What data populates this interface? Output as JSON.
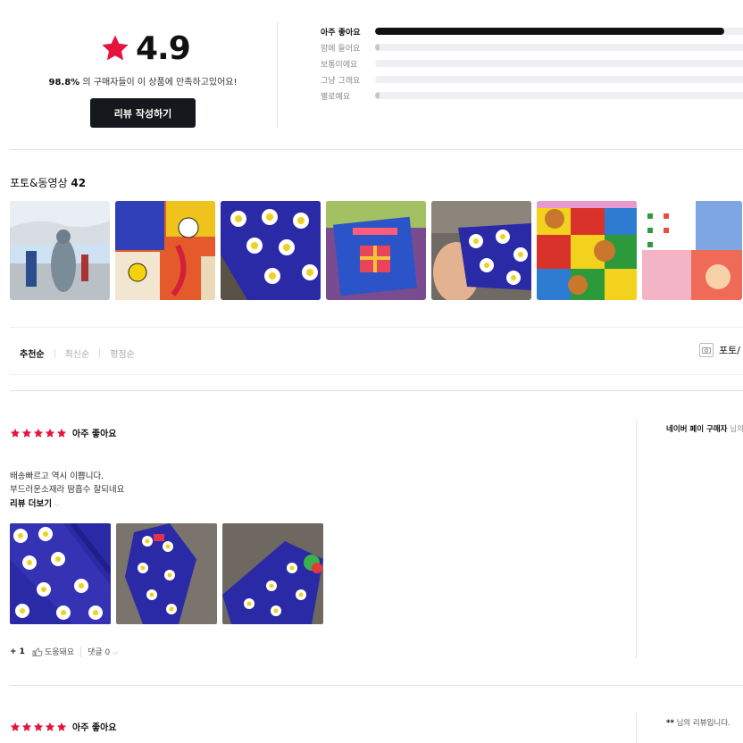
{
  "summary": {
    "rating": "4.9",
    "satisfaction_pct": "98.8%",
    "satisfaction_text": "의 구매자들이 이 상품에 만족하고있어요!",
    "write_review_label": "리뷰 작성하기",
    "distribution": [
      {
        "label": "아주 좋아요",
        "fraction": 0.95
      },
      {
        "label": "맘에 들어요",
        "fraction": 0.012
      },
      {
        "label": "보통이에요",
        "fraction": 0.0
      },
      {
        "label": "그냥 그래요",
        "fraction": 0.0
      },
      {
        "label": "별로예요",
        "fraction": 0.012
      }
    ]
  },
  "photos": {
    "title": "포토&동영상",
    "count": "42"
  },
  "sort": {
    "options": [
      "추천순",
      "최신순",
      "평점순"
    ],
    "photo_filter_label": "포토/"
  },
  "review1": {
    "score_label": "아주 좋아요",
    "stars": 5,
    "lines": [
      "배송빠르고 역시 이쁩니다.",
      "부드러운소재라 땀흡수 잘되네요"
    ],
    "more_label": "리뷰 더보기",
    "plus_label": "+ 1",
    "helpful_label": "도움돼요",
    "comment_label": "댓글 0",
    "buyer_label": "네이버 페이 구매자",
    "buyer_suffix": "님의"
  },
  "review2": {
    "score_label": "아주 좋아요",
    "stars": 5,
    "author_prefix": "**",
    "author_suffix": "님의 리뷰입니다."
  },
  "colors": {
    "star": "#e6143c",
    "button_bg": "#15181c",
    "bar_fill": "#111111",
    "bar_track": "#eef0f4"
  }
}
